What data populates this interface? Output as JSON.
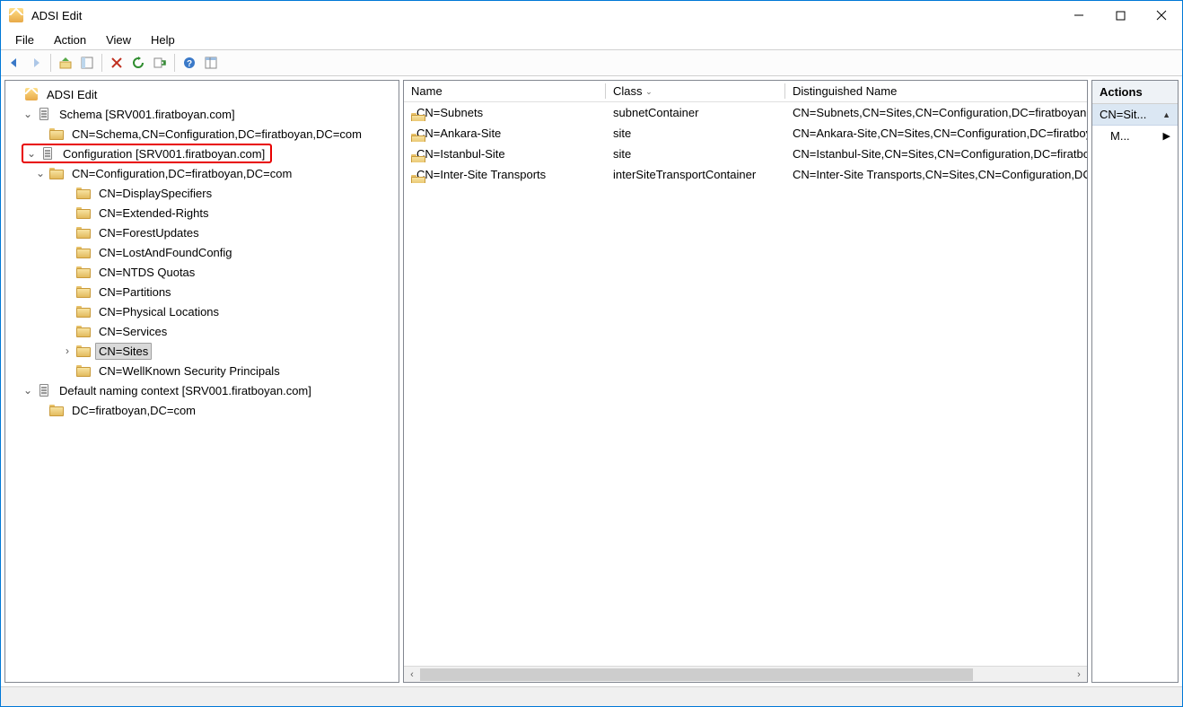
{
  "window": {
    "title": "ADSI Edit"
  },
  "menubar": {
    "items": [
      "File",
      "Action",
      "View",
      "Help"
    ]
  },
  "tree": {
    "root_label": "ADSI Edit",
    "schema_node": "Schema [SRV001.firatboyan.com]",
    "schema_child": "CN=Schema,CN=Configuration,DC=firatboyan,DC=com",
    "config_node": "Configuration [SRV001.firatboyan.com]",
    "config_child": "CN=Configuration,DC=firatboyan,DC=com",
    "config_children": [
      "CN=DisplaySpecifiers",
      "CN=Extended-Rights",
      "CN=ForestUpdates",
      "CN=LostAndFoundConfig",
      "CN=NTDS Quotas",
      "CN=Partitions",
      "CN=Physical Locations",
      "CN=Services",
      "CN=Sites",
      "CN=WellKnown Security Principals"
    ],
    "default_nc_node": "Default naming context [SRV001.firatboyan.com]",
    "default_nc_child": "DC=firatboyan,DC=com"
  },
  "list": {
    "columns": {
      "name": "Name",
      "class": "Class",
      "dn": "Distinguished Name"
    },
    "rows": [
      {
        "name": "CN=Subnets",
        "class": "subnetContainer",
        "dn": "CN=Subnets,CN=Sites,CN=Configuration,DC=firatboyan,DC=com"
      },
      {
        "name": "CN=Ankara-Site",
        "class": "site",
        "dn": "CN=Ankara-Site,CN=Sites,CN=Configuration,DC=firatboyan,DC=com"
      },
      {
        "name": "CN=Istanbul-Site",
        "class": "site",
        "dn": "CN=Istanbul-Site,CN=Sites,CN=Configuration,DC=firatboyan,DC=com"
      },
      {
        "name": "CN=Inter-Site Transports",
        "class": "interSiteTransportContainer",
        "dn": "CN=Inter-Site Transports,CN=Sites,CN=Configuration,DC=firatboyan,DC=com"
      }
    ]
  },
  "actions": {
    "header": "Actions",
    "category": "CN=Sit...",
    "item1": "M..."
  }
}
